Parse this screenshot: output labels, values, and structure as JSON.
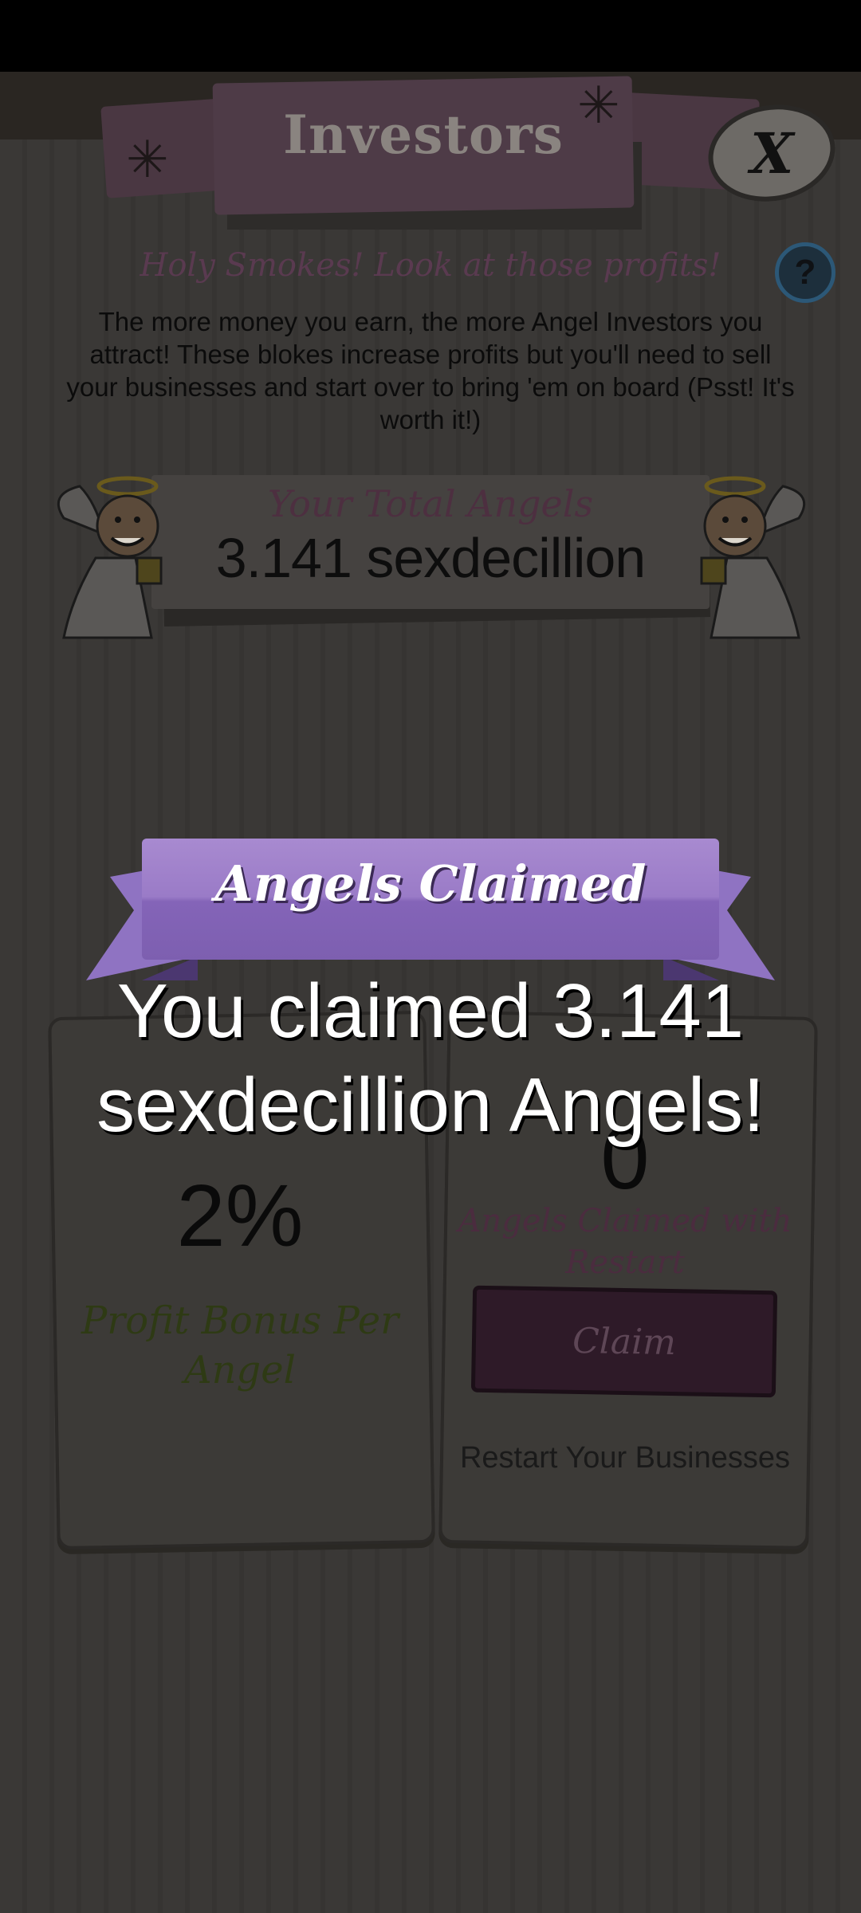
{
  "header": {
    "title": "Investors",
    "close_label": "X",
    "help_label": "?"
  },
  "intro": {
    "subtitle": "Holy Smokes! Look at those profits!",
    "description": "The more money you earn, the more Angel Investors you attract! These blokes increase profits but you'll need to sell your businesses and start over to bring 'em on board (Psst! It's worth it!)"
  },
  "total": {
    "label": "Your Total Angels",
    "value": "3.141 sexdecillion"
  },
  "bonus_card": {
    "value": "2%",
    "label": "Profit Bonus Per Angel"
  },
  "claim_card": {
    "value": "0",
    "label": "Angels Claimed with Restart",
    "button_label": "Claim",
    "restart_label": "Restart Your Businesses"
  },
  "overlay": {
    "ribbon_title": "Angels Claimed",
    "message": "You claimed 3.141 sexdecillion Angels!"
  },
  "colors": {
    "ribbon": "#9a7bc7",
    "panel": "#3a3836",
    "header": "#4e3b47"
  }
}
